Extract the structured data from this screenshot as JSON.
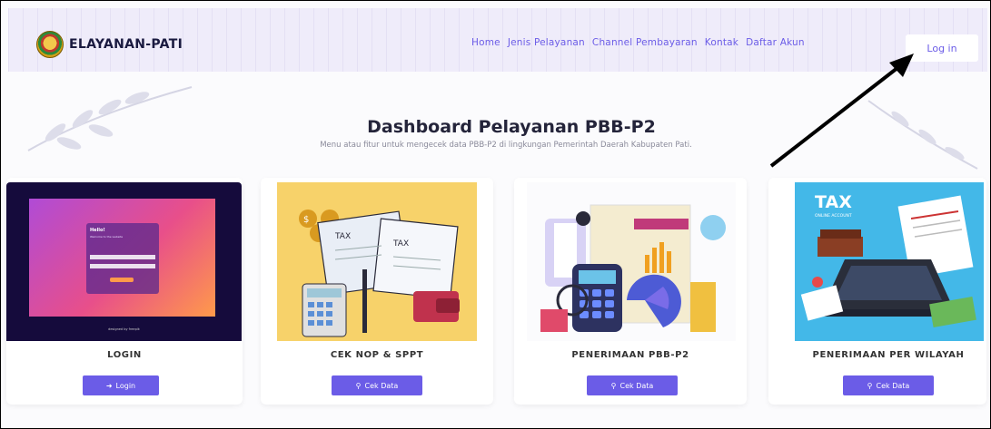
{
  "nav": {
    "brand": "ELAYANAN-PATI",
    "links": [
      "Home",
      "Jenis Pelayanan",
      "Channel Pembayaran",
      "Kontak",
      "Daftar Akun"
    ],
    "login_label": "Log in"
  },
  "hero": {
    "title": "Dashboard Pelayanan PBB-P2",
    "subtitle": "Menu atau fitur untuk mengecek data PBB-P2 di lingkungan Pemerintah Daerah Kabupaten Pati."
  },
  "cards": [
    {
      "title": "LOGIN",
      "button": "Login",
      "button_icon": "sign-in-icon",
      "preview": {
        "heading": "Hello!",
        "sub": "Welcome to the website",
        "footer": "designed by freepik"
      }
    },
    {
      "title": "CEK NOP & SPPT",
      "button": "Cek Data",
      "button_icon": "search-icon",
      "tax_labels": [
        "TAX",
        "TAX"
      ]
    },
    {
      "title": "PENERIMAAN PBB-P2",
      "button": "Cek Data",
      "button_icon": "search-icon"
    },
    {
      "title": "PENERIMAAN PER WILAYAH",
      "button": "Cek Data",
      "button_icon": "search-icon",
      "tax_heading": "TAX",
      "tax_sub": "ONLINE ACCOUNT"
    }
  ],
  "colors": {
    "accent": "#6b5ce7",
    "nav_bg": "#efecfa",
    "arrow": "#000000"
  }
}
